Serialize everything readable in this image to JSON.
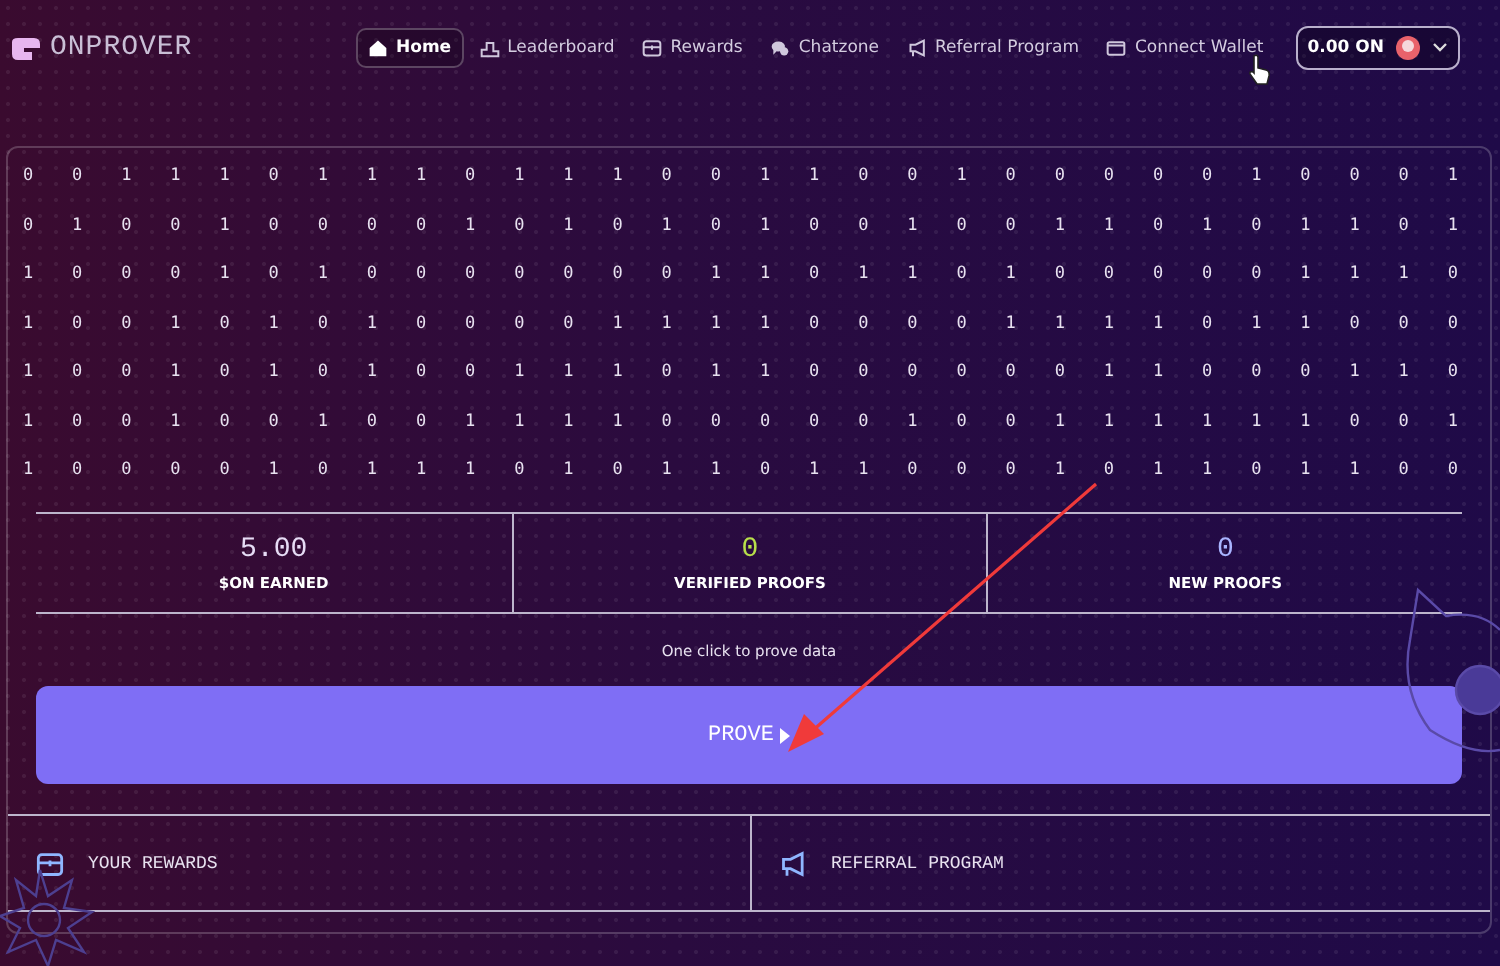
{
  "brand": {
    "name": "ONPROVER"
  },
  "nav": [
    {
      "label": "Home",
      "kind": "home",
      "selected": true
    },
    {
      "label": "Leaderboard",
      "kind": "leaderboard",
      "selected": false
    },
    {
      "label": "Rewards",
      "kind": "rewards",
      "selected": false
    },
    {
      "label": "Chatzone",
      "kind": "chat",
      "selected": false
    },
    {
      "label": "Referral Program",
      "kind": "referral",
      "selected": false
    },
    {
      "label": "Connect Wallet",
      "kind": "wallet",
      "selected": false
    }
  ],
  "balance": {
    "amount": "0.00 ON"
  },
  "bits": [
    [
      "0",
      "0",
      "1",
      "1",
      "1",
      "0",
      "1",
      "1",
      "1",
      "0",
      "1",
      "1",
      "1",
      "0",
      "0",
      "1",
      "1",
      "0",
      "0",
      "1",
      "0",
      "0",
      "0",
      "0",
      "0",
      "1",
      "0",
      "0",
      "0",
      "1"
    ],
    [
      "0",
      "1",
      "0",
      "0",
      "1",
      "0",
      "0",
      "0",
      "0",
      "1",
      "0",
      "1",
      "0",
      "1",
      "0",
      "1",
      "0",
      "0",
      "1",
      "0",
      "0",
      "1",
      "1",
      "0",
      "1",
      "0",
      "1",
      "1",
      "0",
      "1"
    ],
    [
      "1",
      "0",
      "0",
      "0",
      "1",
      "0",
      "1",
      "0",
      "0",
      "0",
      "0",
      "0",
      "0",
      "0",
      "1",
      "1",
      "0",
      "1",
      "1",
      "0",
      "1",
      "0",
      "0",
      "0",
      "0",
      "0",
      "1",
      "1",
      "1",
      "0"
    ],
    [
      "1",
      "0",
      "0",
      "1",
      "0",
      "1",
      "0",
      "1",
      "0",
      "0",
      "0",
      "0",
      "1",
      "1",
      "1",
      "1",
      "0",
      "0",
      "0",
      "0",
      "1",
      "1",
      "1",
      "1",
      "0",
      "1",
      "1",
      "0",
      "0",
      "0"
    ],
    [
      "1",
      "0",
      "0",
      "1",
      "0",
      "1",
      "0",
      "1",
      "0",
      "0",
      "1",
      "1",
      "1",
      "0",
      "1",
      "1",
      "0",
      "0",
      "0",
      "0",
      "0",
      "0",
      "1",
      "1",
      "0",
      "0",
      "0",
      "1",
      "1",
      "0"
    ],
    [
      "1",
      "0",
      "0",
      "1",
      "0",
      "0",
      "1",
      "0",
      "0",
      "1",
      "1",
      "1",
      "1",
      "0",
      "0",
      "0",
      "0",
      "0",
      "1",
      "0",
      "0",
      "1",
      "1",
      "1",
      "1",
      "1",
      "1",
      "0",
      "0",
      "1"
    ],
    [
      "1",
      "0",
      "0",
      "0",
      "0",
      "1",
      "0",
      "1",
      "1",
      "1",
      "0",
      "1",
      "0",
      "1",
      "1",
      "0",
      "1",
      "1",
      "0",
      "0",
      "0",
      "1",
      "0",
      "1",
      "1",
      "0",
      "1",
      "1",
      "0",
      "0"
    ]
  ],
  "stats": [
    {
      "value": "5.00",
      "label": "$ON EARNED",
      "color": "#e6dcf5"
    },
    {
      "value": "0",
      "label": "VERIFIED PROOFS",
      "color": "#b8e04a"
    },
    {
      "value": "0",
      "label": "NEW PROOFS",
      "color": "#a9b4ff"
    }
  ],
  "hint": "One click to prove data",
  "prove_button": {
    "label": "PROVE"
  },
  "links": [
    {
      "label": "YOUR REWARDS",
      "kind": "rewards"
    },
    {
      "label": "REFERRAL PROGRAM",
      "kind": "referral"
    }
  ]
}
